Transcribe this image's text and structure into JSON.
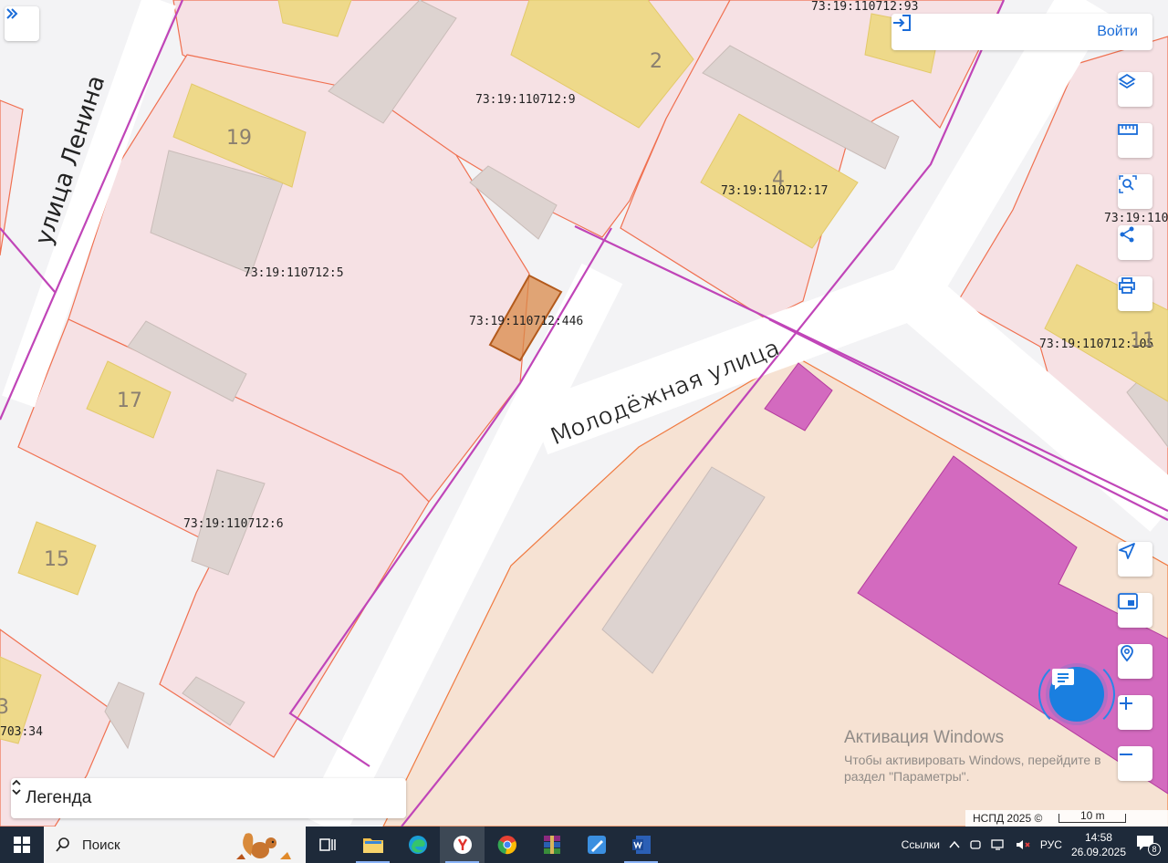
{
  "map": {
    "street_labels": {
      "lenina": "улица Ленина",
      "molodezhnaya": "Молодёжная улица"
    },
    "parcel_labels": [
      {
        "id": "p93",
        "text": "73:19:110712:93"
      },
      {
        "id": "p9",
        "text": "73:19:110712:9"
      },
      {
        "id": "p17",
        "text": "73:19:110712:17"
      },
      {
        "id": "p5",
        "text": "73:19:110712:5"
      },
      {
        "id": "p446",
        "text": "73:19:110712:446"
      },
      {
        "id": "p110",
        "text": "73:19:110"
      },
      {
        "id": "p105",
        "text": "73:19:110712:105"
      },
      {
        "id": "p6",
        "text": "73:19:110712:6"
      },
      {
        "id": "p703",
        "text": "703:34"
      }
    ],
    "house_numbers": [
      {
        "id": "h19",
        "text": "19"
      },
      {
        "id": "h2",
        "text": "2"
      },
      {
        "id": "h4",
        "text": "4"
      },
      {
        "id": "h17",
        "text": "17"
      },
      {
        "id": "h15",
        "text": "15"
      },
      {
        "id": "h3",
        "text": "3"
      },
      {
        "id": "h11",
        "text": "11"
      }
    ],
    "colors": {
      "parcel_fill": "#f6e1e4",
      "parcel_stroke": "#f07050",
      "building_yellow": "#eed98a",
      "building_grey": "#d9c7c5",
      "zone_magenta": "#cc55bb",
      "selected_parcel": "#d98a4a",
      "territory_fill": "#f6e2d3"
    }
  },
  "toolbar": {
    "expand_icon": "double-chevron-right-icon",
    "login_label": "Войти",
    "tools": [
      {
        "name": "layers-button",
        "icon": "layers-icon"
      },
      {
        "name": "ruler-button",
        "icon": "ruler-icon"
      },
      {
        "name": "area-search-button",
        "icon": "area-search-icon"
      },
      {
        "name": "share-button",
        "icon": "share-icon"
      },
      {
        "name": "print-button",
        "icon": "printer-icon"
      }
    ],
    "lower_tools": [
      {
        "name": "locate-button",
        "icon": "navigation-arrow-icon"
      },
      {
        "name": "minimap-button",
        "icon": "picture-in-picture-icon"
      },
      {
        "name": "geo-search-button",
        "icon": "map-pin-search-icon"
      },
      {
        "name": "zoom-in-button",
        "icon": "plus-icon"
      },
      {
        "name": "zoom-out-button",
        "icon": "minus-icon"
      }
    ]
  },
  "legend": {
    "label": "Легенда"
  },
  "attribution": {
    "text": "НСПД 2025 ©",
    "scale": "10 m"
  },
  "watermark": {
    "title": "Активация Windows",
    "line1": "Чтобы активировать Windows, перейдите в",
    "line2": "раздел \"Параметры\"."
  },
  "taskbar": {
    "search_placeholder": "Поиск",
    "apps": [
      "task-view",
      "file-explorer",
      "edge",
      "yandex-browser",
      "chrome",
      "winrar",
      "paint",
      "word"
    ],
    "links_label": "Ссылки",
    "language": "РУС",
    "time": "14:58",
    "date": "26.09.2025",
    "notifications": "8"
  }
}
